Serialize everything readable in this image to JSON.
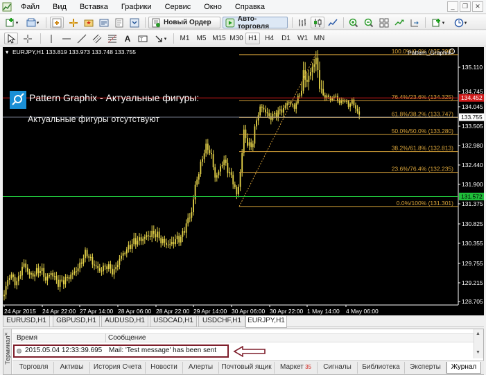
{
  "menu": {
    "items": [
      "Файл",
      "Вид",
      "Вставка",
      "Графики",
      "Сервис",
      "Окно",
      "Справка"
    ]
  },
  "toolbar": {
    "new_order_label": "Новый Ордер",
    "autotrade_label": "Авто-торговля",
    "timeframes": [
      "M1",
      "M5",
      "M15",
      "M30",
      "H1",
      "H4",
      "D1",
      "W1",
      "MN"
    ],
    "active_timeframe": "H1"
  },
  "chart": {
    "header": "EURJPY,H1  133.819 133.973 133.748 133.755",
    "indicator_label": "Pattern_Graphix",
    "panel_title": "Pattern Graphix - Актуальные фигуры:",
    "panel_status": "Актуальные фигуры отсутствуют",
    "price_axis": [
      "135.110",
      "134.745",
      "134.045",
      "133.755",
      "133.505",
      "132.980",
      "132.440",
      "131.900",
      "131.375",
      "130.825",
      "130.355",
      "129.755",
      "129.215",
      "128.705"
    ],
    "price_axis_values": [
      135.11,
      134.745,
      134.045,
      133.755,
      133.505,
      132.98,
      132.44,
      131.9,
      131.375,
      130.825,
      130.355,
      129.755,
      129.215,
      128.705
    ],
    "time_axis": [
      "24 Apr 2015",
      "24 Apr 22:00",
      "27 Apr 14:00",
      "28 Apr 06:00",
      "28 Apr 22:00",
      "29 Apr 14:00",
      "30 Apr 06:00",
      "30 Apr 22:00",
      "1 May 14:00",
      "4 May 06:00"
    ],
    "fib_levels": [
      {
        "label": "100.0%/0.0% (135.299)",
        "price": 135.299
      },
      {
        "label": "76.4%/23.6% (134.325)",
        "price": 134.325
      },
      {
        "label": "61.8%/38.2% (133.747)",
        "price": 133.747
      },
      {
        "label": "50.0%/50.0% (133.280)",
        "price": 133.28
      },
      {
        "label": "38.2%/61.8% (132.813)",
        "price": 132.813
      },
      {
        "label": "23.6%/76.4% (132.235)",
        "price": 132.235
      },
      {
        "label": "0.0%/100% (131.301)",
        "price": 131.301
      }
    ],
    "current_price_tag": "133.755",
    "current_price": 133.755,
    "red_line_tag": "134.452",
    "red_line_price": 134.452,
    "green_line_tag": "131.572",
    "green_line_price": 131.572,
    "colors": {
      "background": "#000000",
      "candle": "#e8d54a",
      "fib": "#d9a43a",
      "red_line": "#d11b1b",
      "green_line": "#1fbf3a",
      "current_line": "#9aa3b8"
    }
  },
  "symbol_tabs": [
    "EURUSD,H1",
    "GBPUSD,H1",
    "AUDUSD,H1",
    "USDCAD,H1",
    "USDCHF,H1",
    "EURJPY,H1"
  ],
  "active_symbol_tab": "EURJPY,H1",
  "terminal": {
    "side_label": "Терминал",
    "columns": {
      "time": "Время",
      "message": "Сообщение"
    },
    "rows": [
      {
        "time": "2015.05.04 12:33:39.695",
        "message": "Mail: 'Test message' has been sent"
      }
    ],
    "tabs": [
      {
        "label": "Торговля"
      },
      {
        "label": "Активы"
      },
      {
        "label": "История Счета"
      },
      {
        "label": "Новости"
      },
      {
        "label": "Алерты"
      },
      {
        "label": "Почтовый ящик"
      },
      {
        "label": "Маркет",
        "badge": "35"
      },
      {
        "label": "Сигналы"
      },
      {
        "label": "Библиотека"
      },
      {
        "label": "Эксперты"
      },
      {
        "label": "Журнал"
      }
    ],
    "active_tab": "Журнал"
  }
}
